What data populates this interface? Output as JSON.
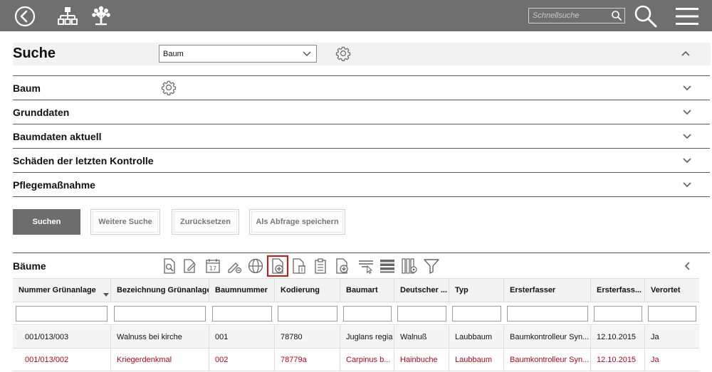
{
  "topbar": {
    "quick_search_placeholder": "Schnellsuche",
    "icons": [
      "back-arrow-icon",
      "org-chart-icon",
      "tree-icon",
      "search-icon",
      "hamburger-menu-icon"
    ]
  },
  "search": {
    "title": "Suche",
    "type_selected": "Baum"
  },
  "sections": [
    {
      "label": "Baum"
    },
    {
      "label": "Grunddaten"
    },
    {
      "label": "Baumdaten aktuell"
    },
    {
      "label": "Schäden der letzten Kontrolle"
    },
    {
      "label": "Pflegemaßnahme"
    }
  ],
  "buttons": {
    "search": "Suchen",
    "more": "Weitere Suche",
    "reset": "Zurücksetzen",
    "save_query": "Als Abfrage speichern"
  },
  "results": {
    "title": "Bäume",
    "columns": [
      "Nummer Grünanlage",
      "Bezeichnung Grünanlage",
      "Baumnummer",
      "Kodierung",
      "Baumart",
      "Deutscher ...",
      "Typ",
      "Ersterfasser",
      "Ersterfass...",
      "Verortet"
    ],
    "sorted_column": "Nummer Grünanlage",
    "rows": [
      [
        "001/013/003",
        "Walnuss bei kirche",
        "001",
        "78780",
        "Juglans regia",
        "Walnuß",
        "Laubbaum",
        "Baumkontrolleur Syn...",
        "12.10.2015",
        "Ja"
      ],
      [
        "001/013/002",
        "Kriegerdenkmal",
        "002",
        "78779a",
        "Carpinus b...",
        "Hainbuche",
        "Laubbaum",
        "Baumkontrolleur Syn...",
        "12.10.2015",
        "Ja"
      ]
    ]
  },
  "colors": {
    "topbar": "#6f6f6f",
    "highlight_border": "#e01010",
    "selected_row_text": "#c0001a"
  }
}
